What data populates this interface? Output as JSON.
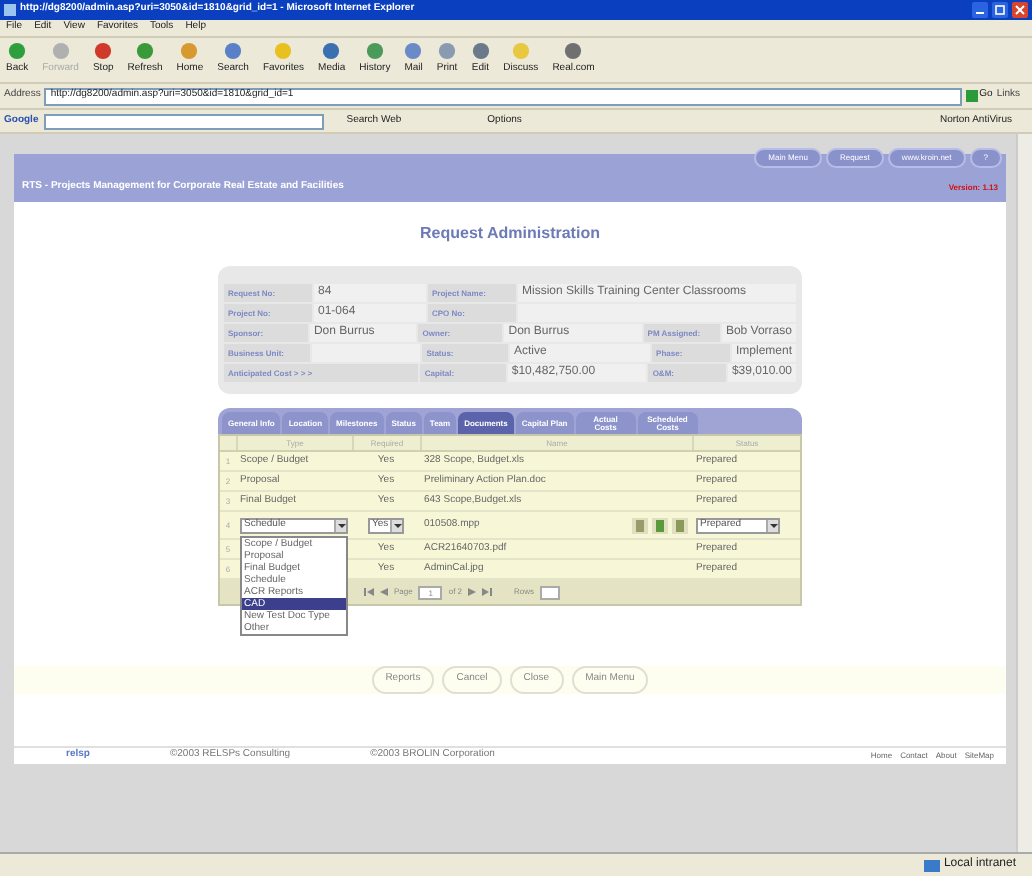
{
  "window": {
    "title": "http://dg8200/admin.asp?uri=3050&id=1810&grid_id=1 - Microsoft Internet Explorer"
  },
  "menu": [
    "File",
    "Edit",
    "View",
    "Favorites",
    "Tools",
    "Help"
  ],
  "toolbar": [
    {
      "label": "Back",
      "disabled": false,
      "color": "#2e9e3e"
    },
    {
      "label": "Forward",
      "disabled": true,
      "color": "#b0b0b0"
    },
    {
      "label": "Stop",
      "disabled": false,
      "color": "#d03a2a"
    },
    {
      "label": "Refresh",
      "disabled": false,
      "color": "#3a9a3a"
    },
    {
      "label": "Home",
      "disabled": false,
      "color": "#d89a30"
    },
    {
      "label": "Search",
      "disabled": false,
      "color": "#5a80c8"
    },
    {
      "label": "Favorites",
      "disabled": false,
      "color": "#e8c020"
    },
    {
      "label": "Media",
      "disabled": false,
      "color": "#3a70b0"
    },
    {
      "label": "History",
      "disabled": false,
      "color": "#4a9a5a"
    },
    {
      "label": "Mail",
      "disabled": false,
      "color": "#6a8ac8"
    },
    {
      "label": "Print",
      "disabled": false,
      "color": "#8a9ab0"
    },
    {
      "label": "Edit",
      "disabled": false,
      "color": "#6a7a8a"
    },
    {
      "label": "Discuss",
      "disabled": false,
      "color": "#e8c840"
    },
    {
      "label": "Real.com",
      "disabled": false,
      "color": "#707070"
    }
  ],
  "address": {
    "label": "Address",
    "url": "http://dg8200/admin.asp?uri=3050&id=1810&grid_id=1",
    "go": "Go",
    "links": "Links"
  },
  "google_bar": {
    "logo": "Google",
    "search": "Search Web",
    "options": "Options",
    "norton": "Norton AntiVirus"
  },
  "app": {
    "title": "RTS - Projects Management for Corporate Real Estate and Facilities",
    "version": "Version: 1.13",
    "nav": [
      "Main Menu",
      "Request",
      "www.kroin.net",
      "?"
    ]
  },
  "page_title": "Request Administration",
  "info": [
    [
      {
        "kind": "label",
        "text": "Request No:"
      },
      {
        "kind": "value",
        "text": "84"
      },
      {
        "kind": "label",
        "text": "Project Name:"
      },
      {
        "kind": "value",
        "text": "Mission Skills Training Center Classrooms"
      }
    ],
    [
      {
        "kind": "label",
        "text": "Project No:"
      },
      {
        "kind": "value",
        "text": "01-064"
      },
      {
        "kind": "label",
        "text": "CPO No:"
      },
      {
        "kind": "blank"
      }
    ],
    [
      {
        "kind": "label",
        "text": "Sponsor:"
      },
      {
        "kind": "value",
        "text": "Don Burrus"
      },
      {
        "kind": "label",
        "text": "Owner:"
      },
      {
        "kind": "value",
        "text": "Don Burrus"
      },
      {
        "kind": "label",
        "text": "PM Assigned:"
      },
      {
        "kind": "value",
        "text": "Bob Vorraso"
      }
    ],
    [
      {
        "kind": "label",
        "text": "Business Unit:"
      },
      {
        "kind": "blank"
      },
      {
        "kind": "label",
        "text": "Status:"
      },
      {
        "kind": "value",
        "text": "Active"
      },
      {
        "kind": "label",
        "text": "Phase:"
      },
      {
        "kind": "value",
        "text": "Implement"
      }
    ],
    [
      {
        "kind": "wide-label",
        "text": "Anticipated Cost > > >"
      },
      {
        "kind": "label",
        "text": "Capital:"
      },
      {
        "kind": "value",
        "text": "$10,482,750.00"
      },
      {
        "kind": "label",
        "text": "O&M:"
      },
      {
        "kind": "value",
        "text": "$39,010.00"
      }
    ]
  ],
  "tabs": [
    {
      "label": "General Info",
      "selected": false
    },
    {
      "label": "Location",
      "selected": false
    },
    {
      "label": "Milestones",
      "selected": false
    },
    {
      "label": "Status",
      "selected": false
    },
    {
      "label": "Team",
      "selected": false
    },
    {
      "label": "Documents",
      "selected": true
    },
    {
      "label": "Capital Plan",
      "selected": false
    },
    {
      "label": "Actual Costs",
      "selected": false
    },
    {
      "label": "Scheduled Costs",
      "selected": false
    }
  ],
  "table": {
    "columns": [
      "Type",
      "Required",
      "Name",
      "Status"
    ],
    "rows": [
      {
        "kind": "static",
        "num": "1",
        "type": "Scope / Budget",
        "required": "Yes",
        "name": "328 Scope, Budget.xls",
        "status": "Prepared"
      },
      {
        "kind": "static",
        "num": "2",
        "type": "Proposal",
        "required": "Yes",
        "name": "Preliminary Action Plan.doc",
        "status": "Prepared"
      },
      {
        "kind": "static",
        "num": "3",
        "type": "Final Budget",
        "required": "Yes",
        "name": "643 Scope,Budget.xls",
        "status": "Prepared"
      },
      {
        "kind": "edit",
        "num": "4",
        "type": "Schedule",
        "required": "Yes",
        "name": "010508.mpp",
        "status": "Prepared",
        "options": [
          {
            "label": "Scope / Budget",
            "selected": false
          },
          {
            "label": "Proposal",
            "selected": false
          },
          {
            "label": "Final Budget",
            "selected": false
          },
          {
            "label": "Schedule",
            "selected": false
          },
          {
            "label": "ACR Reports",
            "selected": false
          },
          {
            "label": "CAD",
            "selected": true
          },
          {
            "label": "New Test Doc Type",
            "selected": false
          },
          {
            "label": "Other",
            "selected": false
          }
        ]
      },
      {
        "kind": "static",
        "num": "5",
        "required": "Yes",
        "name": "ACR21640703.pdf",
        "status": "Prepared"
      },
      {
        "kind": "static",
        "num": "6",
        "required": "Yes",
        "name": "AdminCal.jpg",
        "status": "Prepared"
      }
    ],
    "pager": {
      "page_label": "Page",
      "page": "1",
      "of": "of 2",
      "rows_label": "Rows"
    }
  },
  "buttons": [
    "Reports",
    "Cancel",
    "Close",
    "Main Menu"
  ],
  "footer": {
    "logo": "relsp",
    "copyrights": [
      "©2003 RELSPs Consulting",
      "©2003 BROLIN Corporation"
    ],
    "links": [
      "Home",
      "Contact",
      "About",
      "SiteMap"
    ]
  },
  "status_bar": {
    "zone": "Local intranet"
  }
}
